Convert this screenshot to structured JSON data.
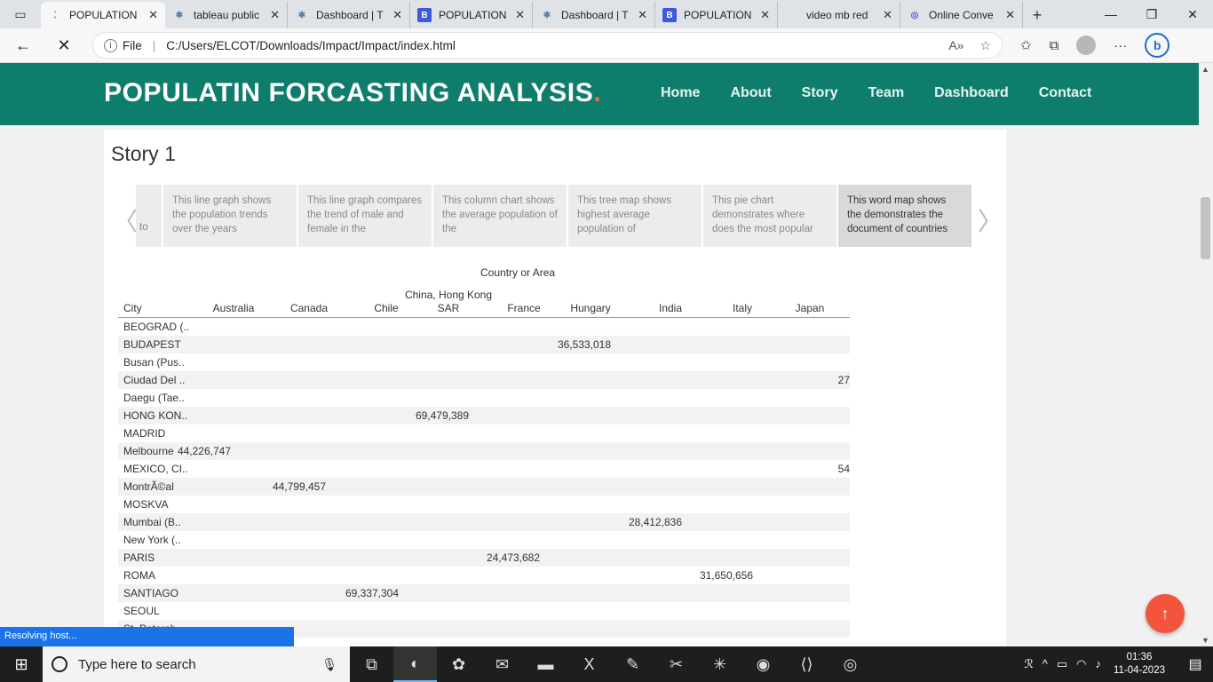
{
  "browser": {
    "tabs": [
      {
        "label": "POPULATION",
        "icon": "loading-dots-icon",
        "active": true
      },
      {
        "label": "tableau public",
        "icon": "tableau-icon"
      },
      {
        "label": "Dashboard | T",
        "icon": "tableau-icon"
      },
      {
        "label": "POPULATION",
        "icon": "b-icon"
      },
      {
        "label": "Dashboard | T",
        "icon": "tableau-icon"
      },
      {
        "label": "POPULATION",
        "icon": "b-icon"
      },
      {
        "label": "video mb red",
        "icon": "blank-icon"
      },
      {
        "label": "Online Conve",
        "icon": "converter-icon"
      }
    ],
    "address": {
      "scheme_label": "File",
      "url": "C:/Users/ELCOT/Downloads/Impact/Impact/index.html"
    },
    "status_text": "Resolving host..."
  },
  "site": {
    "logo_text": "POPULATIN FORCASTING ANALYSIS",
    "logo_dot": ".",
    "nav": [
      "Home",
      "About",
      "Story",
      "Team",
      "Dashboard",
      "Contact"
    ]
  },
  "story": {
    "title": "Story 1",
    "stub_text": "to",
    "points": [
      "This line graph shows the population trends over the years",
      "This line graph compares the trend of male and female in the",
      "This column chart shows the average population of the",
      "This tree map shows highest average population of",
      "This pie chart demonstrates where does the most popular",
      "This word map shows the demonstrates the document of countries"
    ],
    "active_index": 5
  },
  "table": {
    "column_group_title": "Country or Area",
    "row_header": "City",
    "columns": [
      "Australia",
      "Canada",
      "Chile",
      "China, Hong Kong SAR",
      "France",
      "Hungary",
      "India",
      "Italy",
      "Japan"
    ],
    "rows": [
      {
        "city": "BEOGRAD (..",
        "value": "",
        "col": -1
      },
      {
        "city": "BUDAPEST",
        "value": "36,533,018",
        "col": 5
      },
      {
        "city": "Busan (Pus..",
        "value": "",
        "col": -1
      },
      {
        "city": "Ciudad Del ..",
        "value": "27",
        "col": 9
      },
      {
        "city": "Daegu (Tae..",
        "value": "",
        "col": -1
      },
      {
        "city": "HONG KON..",
        "value": "69,479,389",
        "col": 3
      },
      {
        "city": "MADRID",
        "value": "",
        "col": -1
      },
      {
        "city": "Melbourne",
        "value": "44,226,747",
        "col": 0
      },
      {
        "city": "MEXICO, CI..",
        "value": "54",
        "col": 9
      },
      {
        "city": "MontrÃ©al",
        "value": "44,799,457",
        "col": 1
      },
      {
        "city": "MOSKVA",
        "value": "",
        "col": -1
      },
      {
        "city": "Mumbai (B..",
        "value": "28,412,836",
        "col": 6
      },
      {
        "city": "New York (..",
        "value": "",
        "col": -1
      },
      {
        "city": "PARIS",
        "value": "24,473,682",
        "col": 4
      },
      {
        "city": "ROMA",
        "value": "31,650,656",
        "col": 7
      },
      {
        "city": "SANTIAGO",
        "value": "69,337,304",
        "col": 2
      },
      {
        "city": "SEOUL",
        "value": "",
        "col": -1
      },
      {
        "city": "St. Petersb..",
        "value": "",
        "col": -1
      }
    ]
  },
  "taskbar": {
    "search_placeholder": "Type here to search",
    "time": "01:36",
    "date": "11-04-2023"
  }
}
